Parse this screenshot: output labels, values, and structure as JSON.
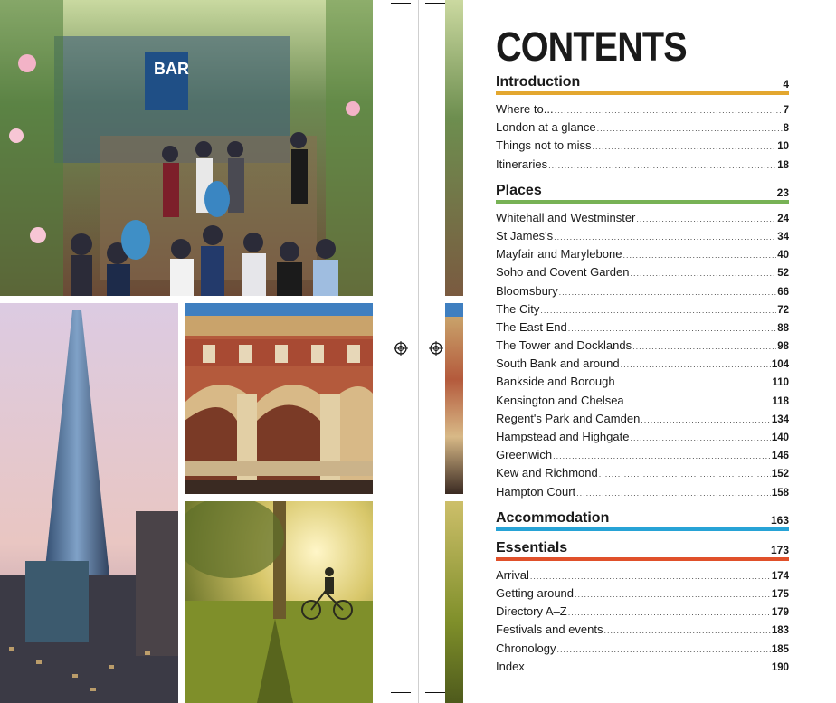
{
  "photos": [
    {
      "name": "photo-rooftop-bar",
      "scene": "rooftop bar with crowd and flowers",
      "sign_text": "BAR"
    },
    {
      "name": "photo-shard",
      "scene": "The Shard skyscraper at dusk"
    },
    {
      "name": "photo-museum-facade",
      "scene": "ornate red-brick museum facade"
    },
    {
      "name": "photo-park-cyclist",
      "scene": "cyclist in a sunlit park"
    }
  ],
  "toc": {
    "title": "CONTENTS",
    "sections": [
      {
        "label": "Introduction",
        "page": "4",
        "color": "#e3a72f",
        "entries": [
          {
            "label": "Where to...",
            "page": "7"
          },
          {
            "label": "London at a glance",
            "page": "8"
          },
          {
            "label": "Things not to miss",
            "page": "10"
          },
          {
            "label": "Itineraries",
            "page": "18"
          }
        ]
      },
      {
        "label": "Places",
        "page": "23",
        "color": "#77b255",
        "entries": [
          {
            "label": "Whitehall and Westminster",
            "page": "24"
          },
          {
            "label": "St James's",
            "page": "34"
          },
          {
            "label": "Mayfair and Marylebone",
            "page": "40"
          },
          {
            "label": "Soho and Covent Garden",
            "page": "52"
          },
          {
            "label": "Bloomsbury",
            "page": "66"
          },
          {
            "label": "The City",
            "page": "72"
          },
          {
            "label": "The East End",
            "page": "88"
          },
          {
            "label": "The Tower and Docklands",
            "page": "98"
          },
          {
            "label": "South Bank and around",
            "page": "104"
          },
          {
            "label": "Bankside and Borough",
            "page": "110"
          },
          {
            "label": "Kensington and Chelsea",
            "page": "118"
          },
          {
            "label": "Regent's Park and Camden",
            "page": "134"
          },
          {
            "label": "Hampstead and Highgate",
            "page": "140"
          },
          {
            "label": "Greenwich",
            "page": "146"
          },
          {
            "label": "Kew and Richmond",
            "page": "152"
          },
          {
            "label": "Hampton Court",
            "page": "158"
          }
        ]
      },
      {
        "label": "Accommodation",
        "page": "163",
        "color": "#27a3d6",
        "entries": []
      },
      {
        "label": "Essentials",
        "page": "173",
        "color": "#e0502a",
        "entries": [
          {
            "label": "Arrival",
            "page": "174"
          },
          {
            "label": "Getting around",
            "page": "175"
          },
          {
            "label": "Directory A–Z",
            "page": "179"
          },
          {
            "label": "Festivals and events",
            "page": "183"
          },
          {
            "label": "Chronology",
            "page": "185"
          },
          {
            "label": "Index",
            "page": "190"
          }
        ]
      }
    ]
  }
}
